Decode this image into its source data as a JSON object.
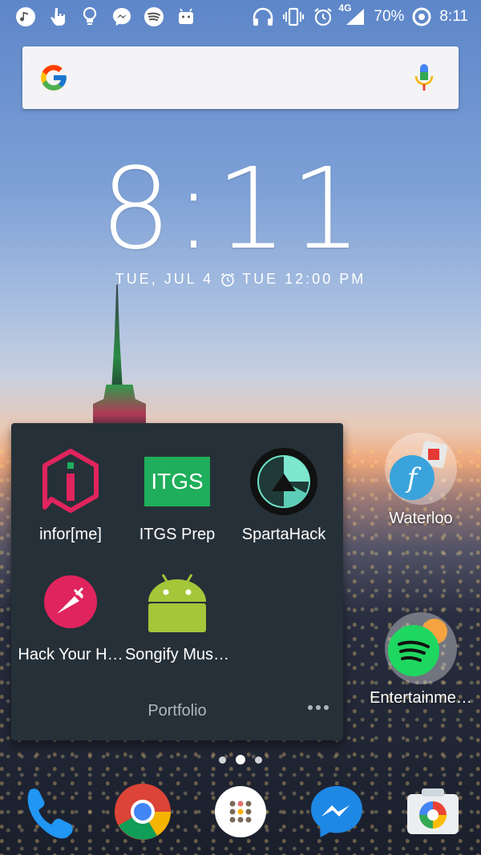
{
  "status_bar": {
    "network": "4G",
    "battery": "70%",
    "time": "8:11",
    "notification_icons": [
      "music-icon",
      "touch-icon",
      "lightbulb-icon",
      "messenger-icon",
      "spotify-icon",
      "android-icon"
    ],
    "system_icons": [
      "headphones-icon",
      "vibrate-icon",
      "alarm-icon",
      "signal-icon",
      "battery-saver-icon"
    ]
  },
  "search_bar": {
    "placeholder": ""
  },
  "clock": {
    "time": "8:11",
    "date": "TUE, JUL 4",
    "alarm": "TUE 12:00 PM"
  },
  "folder": {
    "title": "Portfolio",
    "apps": [
      {
        "label": "infor[me]",
        "icon": "informe-icon"
      },
      {
        "label": "ITGS Prep",
        "icon": "itgs-icon",
        "icon_text": "ITGS"
      },
      {
        "label": "SpartaHack",
        "icon": "spartahack-icon"
      },
      {
        "label": "Hack Your H…",
        "icon": "hack-your-health-icon"
      },
      {
        "label": "Songify Mus…",
        "icon": "android-app-icon"
      }
    ]
  },
  "right_shortcuts": [
    {
      "label": "Waterloo",
      "icon": "waterloo-folder-icon"
    },
    {
      "label": "Entertainme…",
      "icon": "entertainment-folder-icon"
    }
  ],
  "dock": [
    "phone-icon",
    "chrome-icon",
    "app-drawer-icon",
    "messenger-icon",
    "camera-icon"
  ],
  "colors": {
    "folder_bg": "#263038",
    "itgs_green": "#1fae5b",
    "informe_pink": "#e0245e",
    "spotify_green": "#1ed760",
    "android_green": "#a4c639"
  }
}
